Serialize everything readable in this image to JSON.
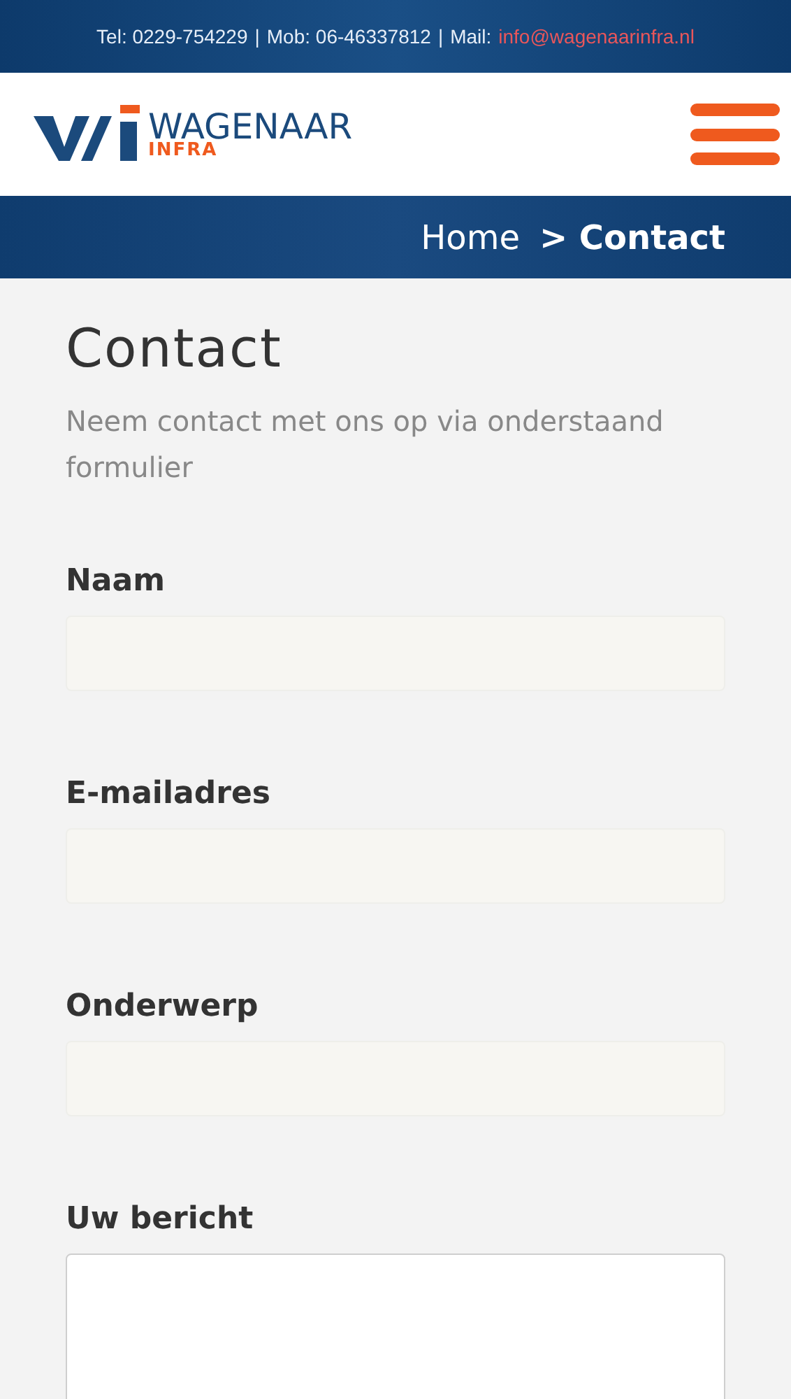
{
  "top_bar": {
    "phone": "Tel: 0229-754229",
    "separator_1": "|",
    "mobile": "Mob: 06-46337812",
    "separator_2": "|",
    "mail_label": "Mail:",
    "mail_link": "info@wagenaarinfra.nl"
  },
  "header": {
    "logo_name": "WAGENAAR",
    "logo_sub": "INFRA"
  },
  "breadcrumb": [
    {
      "label": "Home",
      "selected": false
    },
    {
      "label": "> Contact",
      "selected": true
    }
  ],
  "page": {
    "title": "Contact",
    "intro": "Neem contact met ons op via onderstaand formulier"
  },
  "form": [
    {
      "label": "Naam",
      "kind": "input"
    },
    {
      "label": "E-mailadres",
      "kind": "input"
    },
    {
      "label": "Onderwerp",
      "kind": "input"
    },
    {
      "label": "Uw bericht",
      "kind": "textarea"
    }
  ]
}
